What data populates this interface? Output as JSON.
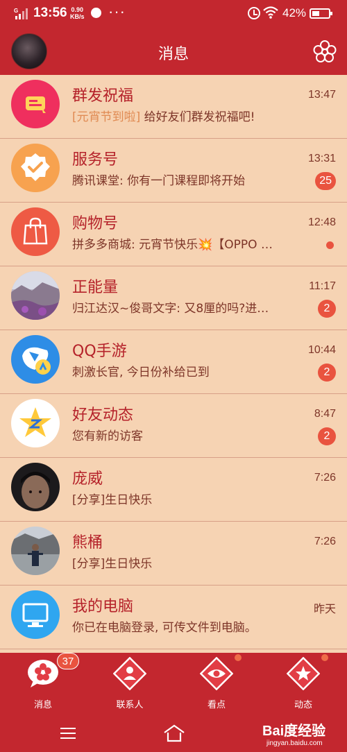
{
  "status_bar": {
    "time": "13:56",
    "net_speed_value": "0.90",
    "net_speed_unit": "KB/s",
    "battery": "42%"
  },
  "header": {
    "title": "消息"
  },
  "conversations": [
    {
      "name": "群发祝福",
      "tag": "[元宵节到啦]",
      "message": "给好友们群发祝福吧!",
      "time": "13:47",
      "badge": null
    },
    {
      "name": "服务号",
      "tag": "",
      "message": "腾讯课堂: 你有一门课程即将开始",
      "time": "13:31",
      "badge": "25"
    },
    {
      "name": "购物号",
      "tag": "",
      "message": "拼多多商城: 元宵节快乐💥【OPPO …",
      "time": "12:48",
      "badge": null
    },
    {
      "name": "正能量",
      "tag": "",
      "message": "归江达汉~俊哥文字: 又8厘的吗?进…",
      "time": "11:17",
      "badge": "2"
    },
    {
      "name": "QQ手游",
      "tag": "",
      "message": "刺激长官, 今日份补给已到",
      "time": "10:44",
      "badge": "2"
    },
    {
      "name": "好友动态",
      "tag": "",
      "message": "您有新的访客",
      "time": "8:47",
      "badge": "2"
    },
    {
      "name": "庞威",
      "tag": "",
      "message": "[分享]生日快乐",
      "time": "7:26",
      "badge": null
    },
    {
      "name": "熊桶",
      "tag": "",
      "message": "[分享]生日快乐",
      "time": "7:26",
      "badge": null
    },
    {
      "name": "我的电脑",
      "tag": "",
      "message": "你已在电脑登录, 可传文件到电脑。",
      "time": "昨天",
      "badge": null
    }
  ],
  "tabs": [
    {
      "label": "消息",
      "badge": "37"
    },
    {
      "label": "联系人",
      "badge": null
    },
    {
      "label": "看点",
      "badge": null
    },
    {
      "label": "动态",
      "badge": null
    }
  ],
  "watermark": {
    "brand": "Bai度经验",
    "url": "jingyan.baidu.com"
  },
  "colors": {
    "theme_red": "#c3272f",
    "list_background": "#f6d3b3",
    "name_red": "#b5222a",
    "badge_red": "#e9533f"
  }
}
